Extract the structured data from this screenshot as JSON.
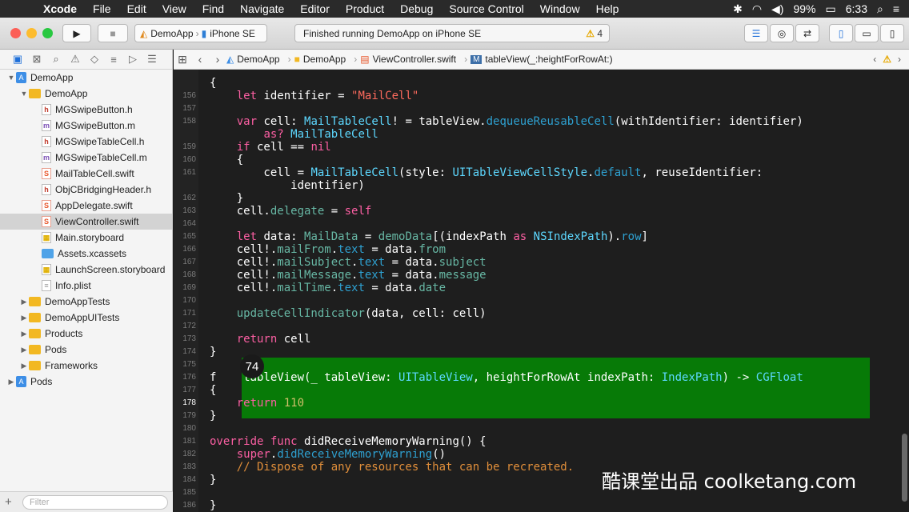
{
  "menubar": {
    "apple": "",
    "app": "Xcode",
    "items": [
      "File",
      "Edit",
      "View",
      "Find",
      "Navigate",
      "Editor",
      "Product",
      "Debug",
      "Source Control",
      "Window",
      "Help"
    ],
    "battery": "99%",
    "clock": "6:33"
  },
  "toolbar": {
    "scheme_project": "DemoApp",
    "scheme_device": "iPhone SE",
    "activity_status": "Finished running DemoApp on iPhone SE",
    "warning_count": "4"
  },
  "navigator": {
    "filter_placeholder": "Filter",
    "items": [
      {
        "label": "DemoApp",
        "kind": "project",
        "depth": 0,
        "expanded": true,
        "selected": false
      },
      {
        "label": "DemoApp",
        "kind": "folder",
        "depth": 1,
        "expanded": true,
        "selected": false
      },
      {
        "label": "MGSwipeButton.h",
        "kind": "h",
        "depth": 2,
        "selected": false
      },
      {
        "label": "MGSwipeButton.m",
        "kind": "m",
        "depth": 2,
        "selected": false
      },
      {
        "label": "MGSwipeTableCell.h",
        "kind": "h",
        "depth": 2,
        "selected": false
      },
      {
        "label": "MGSwipeTableCell.m",
        "kind": "m",
        "depth": 2,
        "selected": false
      },
      {
        "label": "MailTableCell.swift",
        "kind": "swift",
        "depth": 2,
        "selected": false
      },
      {
        "label": "ObjCBridgingHeader.h",
        "kind": "h",
        "depth": 2,
        "selected": false
      },
      {
        "label": "AppDelegate.swift",
        "kind": "swift",
        "depth": 2,
        "selected": false
      },
      {
        "label": "ViewController.swift",
        "kind": "swift",
        "depth": 2,
        "selected": true
      },
      {
        "label": "Main.storyboard",
        "kind": "sb",
        "depth": 2,
        "selected": false
      },
      {
        "label": "Assets.xcassets",
        "kind": "assets",
        "depth": 2,
        "selected": false
      },
      {
        "label": "LaunchScreen.storyboard",
        "kind": "sb",
        "depth": 2,
        "selected": false
      },
      {
        "label": "Info.plist",
        "kind": "plist",
        "depth": 2,
        "selected": false
      },
      {
        "label": "DemoAppTests",
        "kind": "folder",
        "depth": 1,
        "expanded": false,
        "selected": false
      },
      {
        "label": "DemoAppUITests",
        "kind": "folder",
        "depth": 1,
        "expanded": false,
        "selected": false
      },
      {
        "label": "Products",
        "kind": "folder",
        "depth": 1,
        "expanded": false,
        "selected": false
      },
      {
        "label": "Pods",
        "kind": "folder",
        "depth": 1,
        "expanded": false,
        "selected": false
      },
      {
        "label": "Frameworks",
        "kind": "folder",
        "depth": 1,
        "expanded": false,
        "selected": false
      },
      {
        "label": "Pods",
        "kind": "project",
        "depth": 0,
        "expanded": false,
        "selected": false
      }
    ]
  },
  "jumpbar": {
    "crumbs": [
      "DemoApp",
      "DemoApp",
      "ViewController.swift",
      "tableView(_:heightForRowAt:)"
    ]
  },
  "editor": {
    "current_line": "178",
    "badge": "74",
    "watermark": "酷课堂出品 coolketang.com",
    "lines": [
      {
        "n": "",
        "tokens": [
          [
            "",
            "{"
          ]
        ]
      },
      {
        "n": "156",
        "tokens": [
          [
            "",
            "    "
          ],
          [
            "kw",
            "let"
          ],
          [
            "",
            " identifier = "
          ],
          [
            "str",
            "\"MailCell\""
          ]
        ]
      },
      {
        "n": "157",
        "tokens": []
      },
      {
        "n": "158",
        "tokens": [
          [
            "",
            "    "
          ],
          [
            "kw",
            "var"
          ],
          [
            "",
            " cell: "
          ],
          [
            "ty",
            "MailTableCell"
          ],
          [
            "",
            "! = tableView."
          ],
          [
            "pr",
            "dequeueReusableCell"
          ],
          [
            "",
            "(withIdentifier: identifier)"
          ]
        ]
      },
      {
        "n": "",
        "tokens": [
          [
            "",
            "        "
          ],
          [
            "kw",
            "as?"
          ],
          [
            "",
            " "
          ],
          [
            "ty",
            "MailTableCell"
          ]
        ]
      },
      {
        "n": "159",
        "tokens": [
          [
            "",
            "    "
          ],
          [
            "kw",
            "if"
          ],
          [
            "",
            " cell == "
          ],
          [
            "kw",
            "nil"
          ]
        ]
      },
      {
        "n": "160",
        "tokens": [
          [
            "",
            "    {"
          ]
        ]
      },
      {
        "n": "161",
        "tokens": [
          [
            "",
            "        cell = "
          ],
          [
            "ty",
            "MailTableCell"
          ],
          [
            "",
            "(style: "
          ],
          [
            "ty",
            "UITableViewCellStyle"
          ],
          [
            "",
            "."
          ],
          [
            "pr",
            "default"
          ],
          [
            "",
            ", reuseIdentifier:"
          ]
        ]
      },
      {
        "n": "",
        "tokens": [
          [
            "",
            "            identifier)"
          ]
        ]
      },
      {
        "n": "162",
        "tokens": [
          [
            "",
            "    }"
          ]
        ]
      },
      {
        "n": "163",
        "tokens": [
          [
            "",
            "    cell."
          ],
          [
            "fn",
            "delegate"
          ],
          [
            "",
            " = "
          ],
          [
            "kw",
            "self"
          ]
        ]
      },
      {
        "n": "164",
        "tokens": []
      },
      {
        "n": "165",
        "tokens": [
          [
            "",
            "    "
          ],
          [
            "kw",
            "let"
          ],
          [
            "",
            " data: "
          ],
          [
            "fn",
            "MailData"
          ],
          [
            "",
            " = "
          ],
          [
            "fn",
            "demoData"
          ],
          [
            "",
            "[(indexPath "
          ],
          [
            "kw",
            "as"
          ],
          [
            "",
            " "
          ],
          [
            "ty",
            "NSIndexPath"
          ],
          [
            "",
            ")."
          ],
          [
            "pr",
            "row"
          ],
          [
            "",
            "]"
          ]
        ]
      },
      {
        "n": "166",
        "tokens": [
          [
            "",
            "    cell!."
          ],
          [
            "fn",
            "mailFrom"
          ],
          [
            "",
            "."
          ],
          [
            "pr",
            "text"
          ],
          [
            "",
            " = data."
          ],
          [
            "fn",
            "from"
          ]
        ]
      },
      {
        "n": "167",
        "tokens": [
          [
            "",
            "    cell!."
          ],
          [
            "fn",
            "mailSubject"
          ],
          [
            "",
            "."
          ],
          [
            "pr",
            "text"
          ],
          [
            "",
            " = data."
          ],
          [
            "fn",
            "subject"
          ]
        ]
      },
      {
        "n": "168",
        "tokens": [
          [
            "",
            "    cell!."
          ],
          [
            "fn",
            "mailMessage"
          ],
          [
            "",
            "."
          ],
          [
            "pr",
            "text"
          ],
          [
            "",
            " = data."
          ],
          [
            "fn",
            "message"
          ]
        ]
      },
      {
        "n": "169",
        "tokens": [
          [
            "",
            "    cell!."
          ],
          [
            "fn",
            "mailTime"
          ],
          [
            "",
            "."
          ],
          [
            "pr",
            "text"
          ],
          [
            "",
            " = data."
          ],
          [
            "fn",
            "date"
          ]
        ]
      },
      {
        "n": "170",
        "tokens": []
      },
      {
        "n": "171",
        "tokens": [
          [
            "",
            "    "
          ],
          [
            "fn",
            "updateCellIndicator"
          ],
          [
            "",
            "(data, cell: cell)"
          ]
        ]
      },
      {
        "n": "172",
        "tokens": []
      },
      {
        "n": "173",
        "tokens": [
          [
            "",
            "    "
          ],
          [
            "kw",
            "return"
          ],
          [
            "",
            " cell"
          ]
        ]
      },
      {
        "n": "174",
        "tokens": [
          [
            "",
            "}"
          ]
        ]
      },
      {
        "n": "175",
        "tokens": []
      },
      {
        "n": "176",
        "tokens": [
          [
            "",
            "f    tableView(_ tableView: "
          ],
          [
            "ty",
            "UITableView"
          ],
          [
            "",
            ", heightForRowAt indexPath: "
          ],
          [
            "ty",
            "IndexPath"
          ],
          [
            "",
            ") -> "
          ],
          [
            "ty",
            "CGFloat"
          ]
        ]
      },
      {
        "n": "177",
        "tokens": [
          [
            "",
            "{"
          ]
        ]
      },
      {
        "n": "178",
        "tokens": [
          [
            "",
            "    "
          ],
          [
            "kw",
            "return"
          ],
          [
            "",
            " "
          ],
          [
            "num",
            "110"
          ]
        ]
      },
      {
        "n": "179",
        "tokens": [
          [
            "",
            "}"
          ]
        ]
      },
      {
        "n": "180",
        "tokens": []
      },
      {
        "n": "181",
        "tokens": [
          [
            "kw",
            "override"
          ],
          [
            "",
            " "
          ],
          [
            "kw",
            "func"
          ],
          [
            "",
            " didReceiveMemoryWarning() {"
          ]
        ]
      },
      {
        "n": "182",
        "tokens": [
          [
            "",
            "    "
          ],
          [
            "kw",
            "super"
          ],
          [
            "",
            "."
          ],
          [
            "pr",
            "didReceiveMemoryWarning"
          ],
          [
            "",
            "()"
          ]
        ]
      },
      {
        "n": "183",
        "tokens": [
          [
            "",
            "    "
          ],
          [
            "cm",
            "// Dispose of any resources that can be recreated."
          ]
        ]
      },
      {
        "n": "184",
        "tokens": [
          [
            "",
            "}"
          ]
        ]
      },
      {
        "n": "185",
        "tokens": []
      },
      {
        "n": "186",
        "tokens": [
          [
            "",
            "}"
          ]
        ]
      },
      {
        "n": "187",
        "tokens": []
      }
    ]
  },
  "colors": {
    "highlight": "#077a07",
    "keyword": "#fc5fa3",
    "string": "#fc6a5d",
    "type": "#5dd8ff",
    "project_member": "#67b7a4",
    "number": "#d0bf69",
    "comment": "#e08e3a"
  },
  "icons": [
    "apple-icon",
    "bluetooth-icon",
    "wifi-icon",
    "volume-icon",
    "battery-icon",
    "search-icon",
    "menu-icon",
    "run-icon",
    "stop-icon",
    "warning-icon",
    "folder-icon",
    "grid-icon"
  ]
}
